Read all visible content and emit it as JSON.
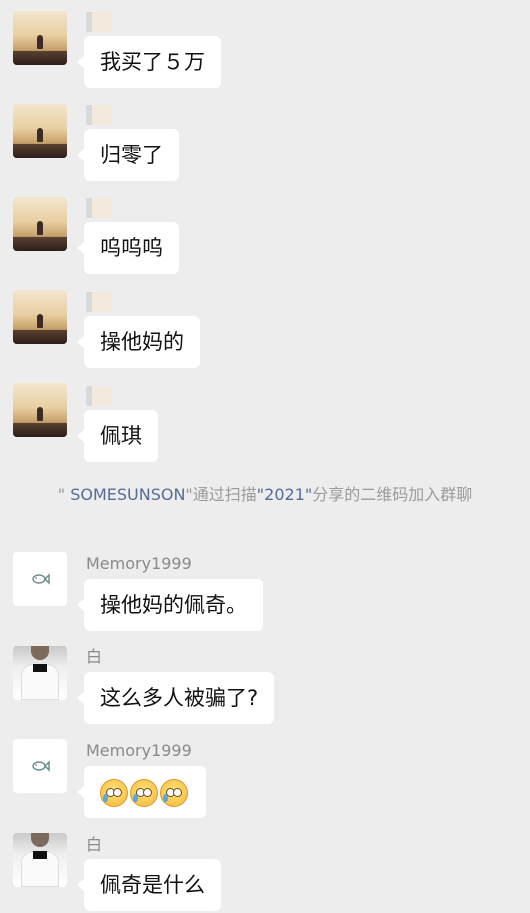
{
  "messages": [
    {
      "sender": "",
      "text": "我买了５万",
      "avatar": "sunset-avatar"
    },
    {
      "sender": "",
      "text": "归零了",
      "avatar": "sunset-avatar"
    },
    {
      "sender": "",
      "text": "呜呜呜",
      "avatar": "sunset-avatar"
    },
    {
      "sender": "",
      "text": "操他妈的",
      "avatar": "sunset-avatar"
    },
    {
      "sender": "",
      "text": "佩琪",
      "avatar": "sunset-avatar"
    }
  ],
  "system_notice": {
    "quote_open": "\"",
    "inviter": " SOMESUNSON",
    "quote_close": "\"",
    "via": "通过扫描",
    "code_owner": "\"2021\"",
    "action": "分享的二维码加入群聊"
  },
  "group_messages": [
    {
      "sender": "Memory1999",
      "text": "操他妈的佩奇。",
      "avatar": "fish-avatar"
    },
    {
      "sender": "白",
      "text": "这么多人被骗了?",
      "avatar": "person-avatar"
    },
    {
      "sender": "Memory1999",
      "text": "",
      "emoji": [
        "crying-face-emoji",
        "crying-face-emoji",
        "crying-face-emoji"
      ],
      "avatar": "fish-avatar"
    },
    {
      "sender": "白",
      "text": "佩奇是什么",
      "avatar": "person-avatar"
    }
  ]
}
